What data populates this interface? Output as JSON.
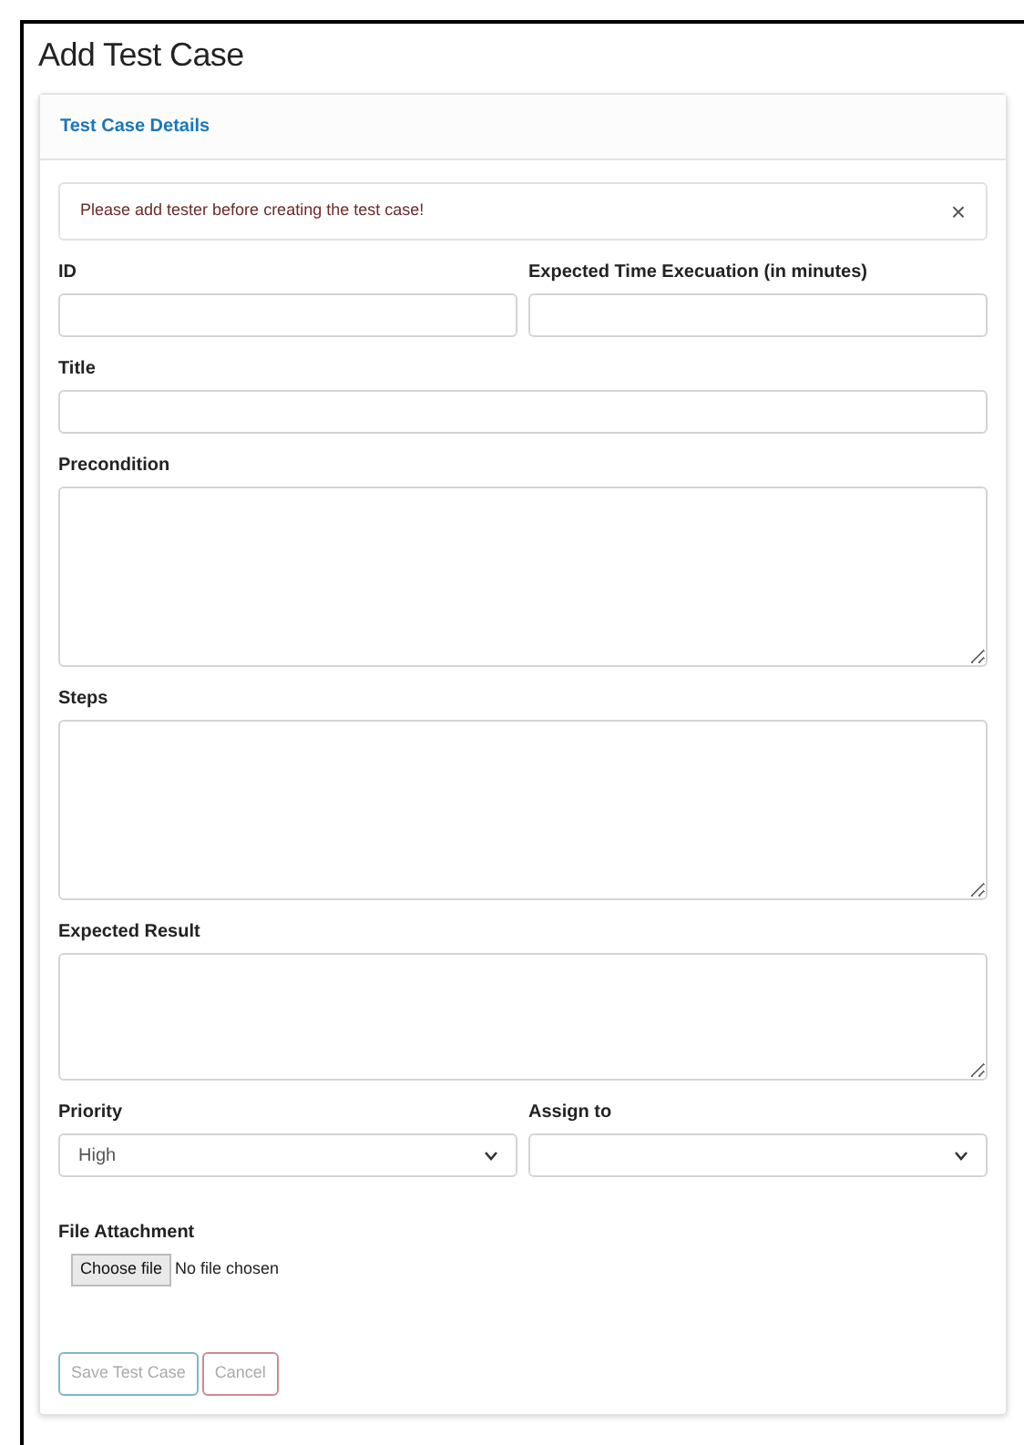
{
  "page": {
    "title": "Add Test Case"
  },
  "card": {
    "header": "Test Case Details"
  },
  "alert": {
    "message": "Please add tester before creating the test case!",
    "close": "×"
  },
  "rows": [
    {
      "fields": [
        {
          "kind": "input",
          "label": "ID"
        },
        {
          "kind": "input",
          "label": "Expected Time Execuation (in minutes)"
        }
      ]
    },
    {
      "fields": [
        {
          "kind": "input",
          "label": "Title"
        }
      ]
    },
    {
      "fields": [
        {
          "kind": "textarea",
          "label": "Precondition"
        }
      ]
    },
    {
      "fields": [
        {
          "kind": "textarea",
          "label": "Steps"
        }
      ]
    },
    {
      "fields": [
        {
          "kind": "memo",
          "label": "Expected Result"
        }
      ]
    },
    {
      "fields": [
        {
          "kind": "select",
          "label": "Priority",
          "value": "High"
        },
        {
          "kind": "select",
          "label": "Assign to"
        }
      ]
    }
  ],
  "attachment": {
    "label": "File Attachment",
    "button": "Choose file",
    "status": "No file chosen"
  },
  "buttons": [
    {
      "label": "Save Test Case",
      "color": "#7fb6c8",
      "disabled": true
    },
    {
      "label": "Cancel",
      "color": "#c98a96",
      "disabled": true
    }
  ]
}
